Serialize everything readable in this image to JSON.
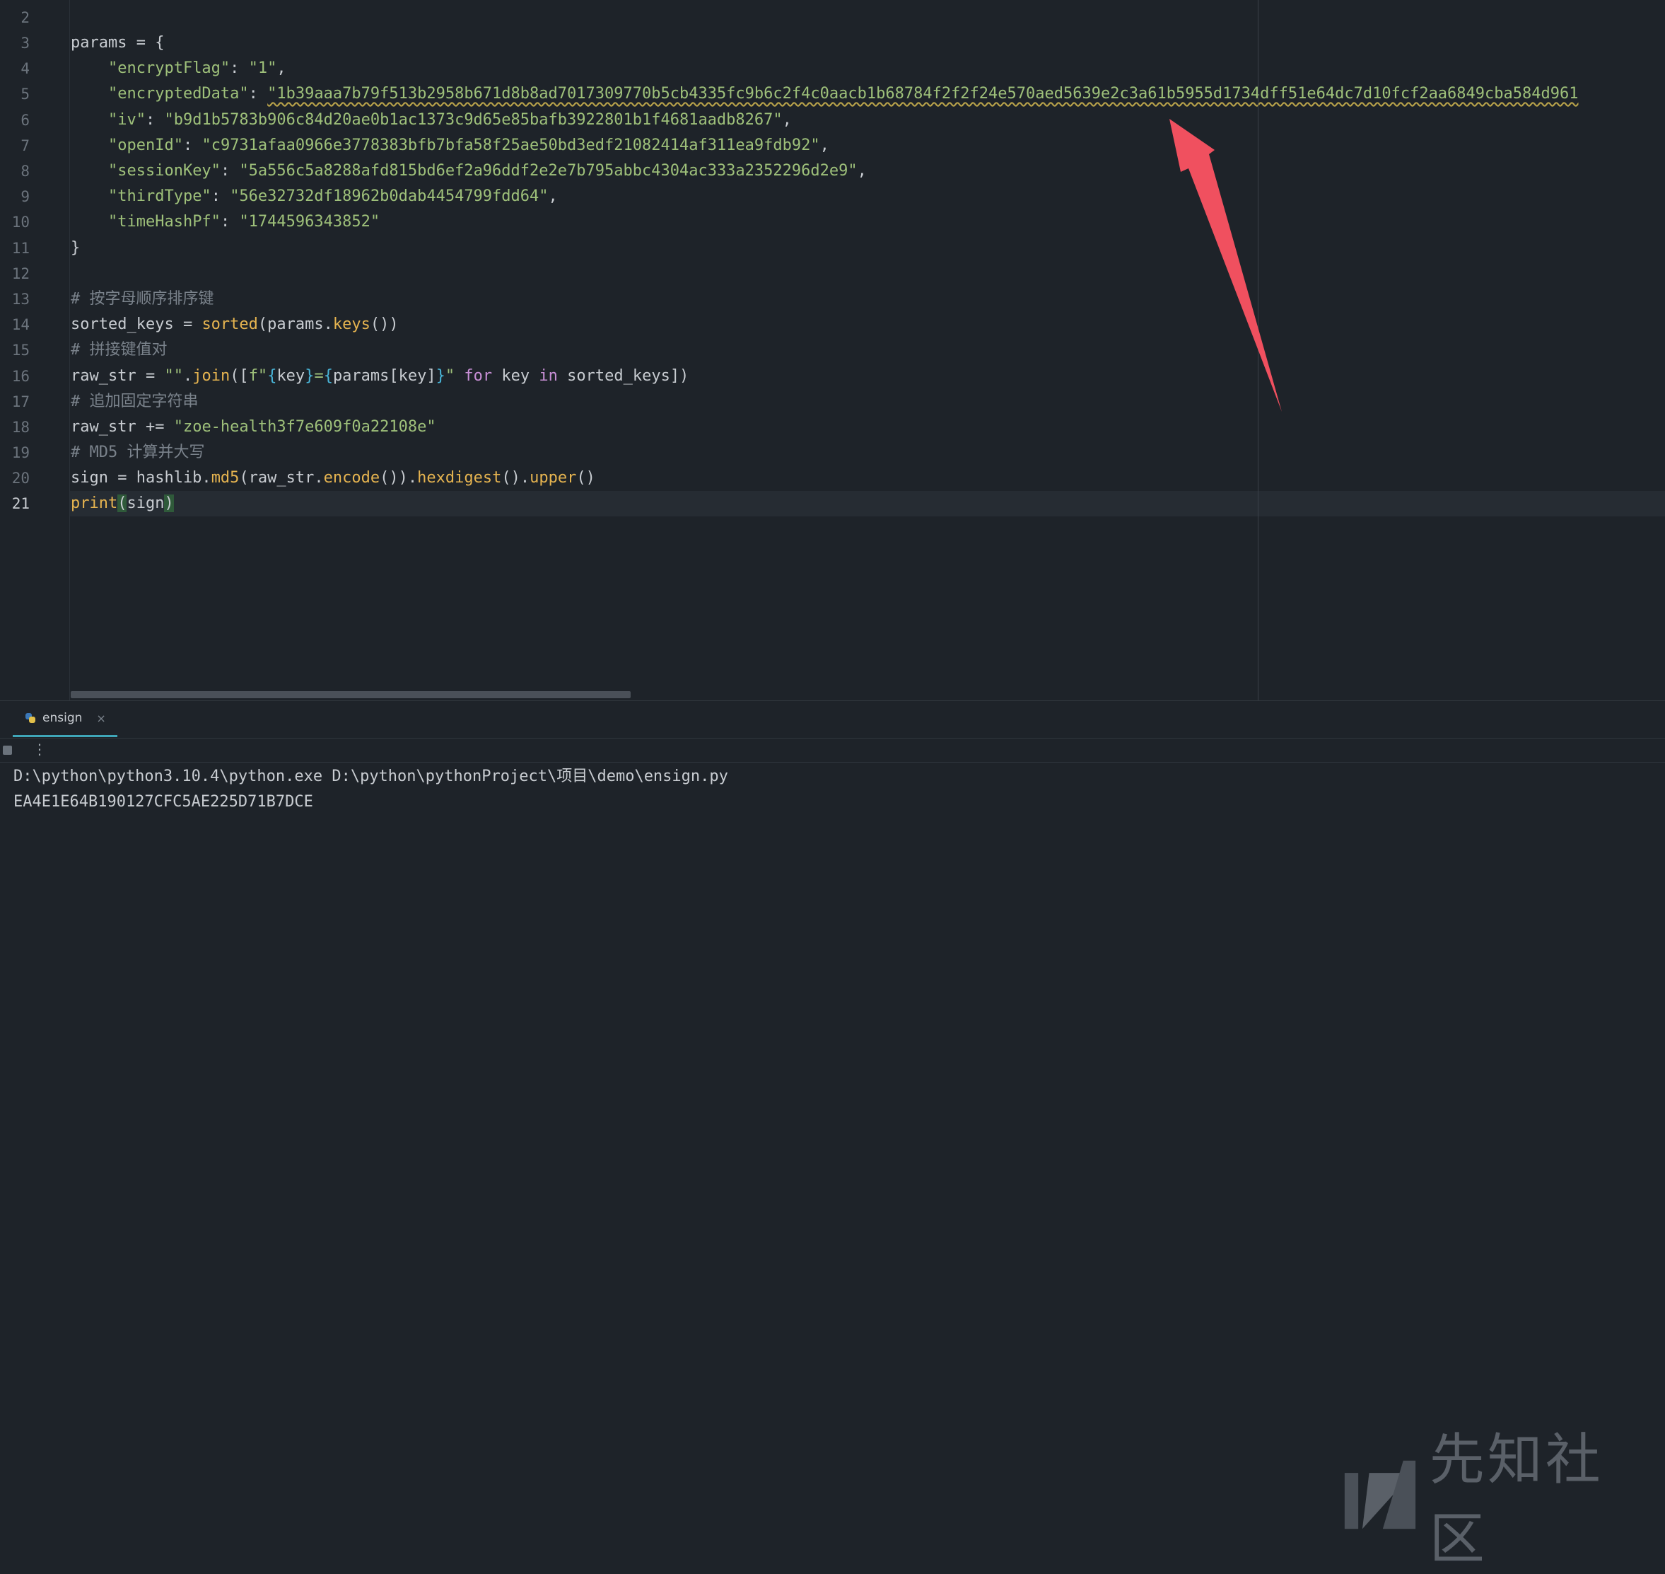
{
  "editor": {
    "line_numbers": [
      "2",
      "3",
      "4",
      "5",
      "6",
      "7",
      "8",
      "9",
      "10",
      "11",
      "12",
      "13",
      "14",
      "15",
      "16",
      "17",
      "18",
      "19",
      "20",
      "21"
    ],
    "current_line": "21",
    "code": {
      "params_open": "params = {",
      "encrypt_flag_key": "\"encryptFlag\"",
      "encrypt_flag_val": "\"1\"",
      "encrypted_data_key": "\"encryptedData\"",
      "encrypted_data_val": "\"1b39aaa7b79f513b2958b671d8b8ad7017309770b5cb4335fc9b6c2f4c0aacb1b68784f2f2f24e570aed5639e2c3a61b5955d1734dff51e64dc7d10fcf2aa6849cba584d961",
      "iv_key": "\"iv\"",
      "iv_val": "\"b9d1b5783b906c84d20ae0b1ac1373c9d65e85bafb3922801b1f4681aadb8267\"",
      "open_id_key": "\"openId\"",
      "open_id_val": "\"c9731afaa0966e3778383bfb7bfa58f25ae50bd3edf21082414af311ea9fdb92\"",
      "session_key_key": "\"sessionKey\"",
      "session_key_val": "\"5a556c5a8288afd815bd6ef2a96ddf2e2e7b795abbc4304ac333a2352296d2e9\"",
      "third_type_key": "\"thirdType\"",
      "third_type_val": "\"56e32732df18962b0dab4454799fdd64\"",
      "time_hash_key": "\"timeHashPf\"",
      "time_hash_val": "\"1744596343852\"",
      "params_close": "}",
      "comment_sort": "# 按字母顺序排序键",
      "comment_join": "# 拼接键值对",
      "comment_append": "# 追加固定字符串",
      "comment_md5": "# MD5 计算并大写",
      "raw_str_suffix": "\"zoe-health3f7e609f0a22108e\""
    }
  },
  "run_panel": {
    "tab_label": "ensign",
    "tab_close": "×",
    "more_glyph": "⋮",
    "output_lines": [
      "D:\\python\\python3.10.4\\python.exe D:\\python\\pythonProject\\项目\\demo\\ensign.py",
      "EA4E1E64B190127CFC5AE225D71B7DCE"
    ]
  },
  "watermark": {
    "text": "先知社区"
  },
  "colors": {
    "background": "#1e2329",
    "string": "#9ec07a",
    "comment": "#7b838c",
    "function": "#e6b450",
    "keyword": "#c88fd6",
    "arrow": "#f0505f",
    "tab_underline": "#3fa6b8"
  },
  "icons": [
    "python-file-icon",
    "stop-icon",
    "more-options-icon",
    "annotation-arrow"
  ]
}
